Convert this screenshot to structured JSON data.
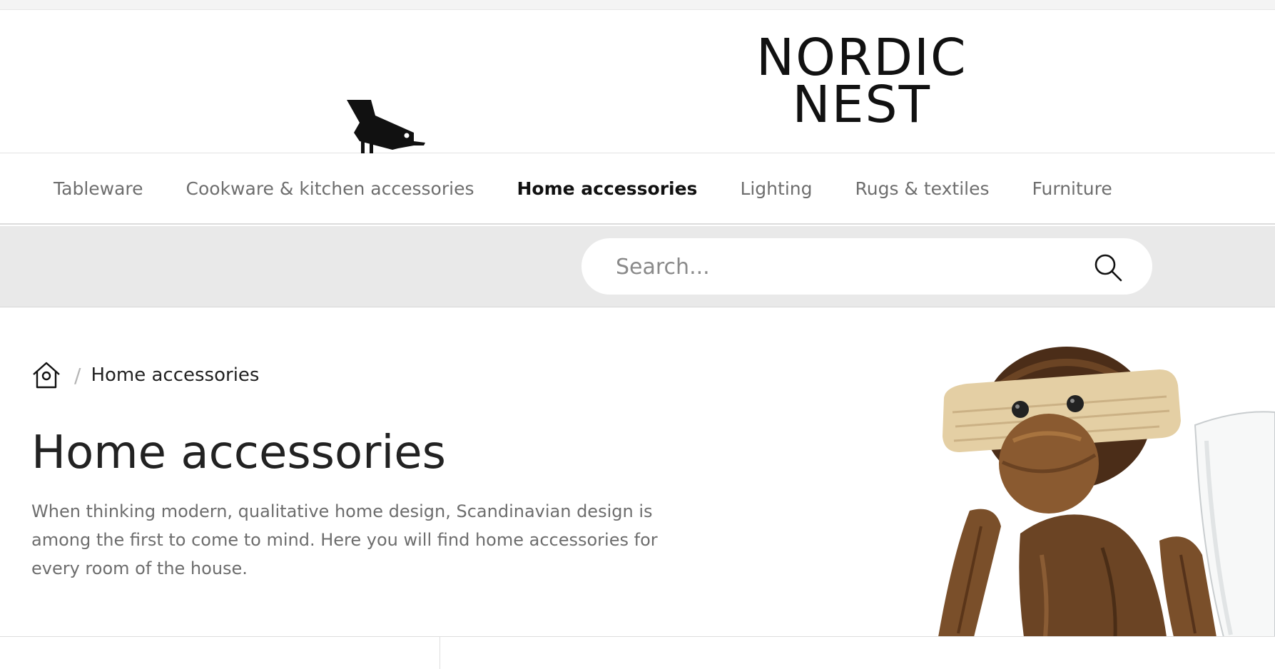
{
  "brand": {
    "logo_line1": "NORDIC",
    "logo_line2": "NEST"
  },
  "nav": {
    "items": [
      {
        "label": "Tableware",
        "active": false
      },
      {
        "label": "Cookware & kitchen accessories",
        "active": false
      },
      {
        "label": "Home accessories",
        "active": true
      },
      {
        "label": "Lighting",
        "active": false
      },
      {
        "label": "Rugs & textiles",
        "active": false
      },
      {
        "label": "Furniture",
        "active": false
      }
    ]
  },
  "search": {
    "placeholder": "Search...",
    "icon": "search-icon"
  },
  "breadcrumb": {
    "home_icon": "home-icon",
    "separator": "/",
    "current": "Home accessories"
  },
  "page": {
    "title": "Home accessories",
    "description": "When thinking modern, qualitative home design, Scandinavian design is among the first to come to mind. Here you will find home accessories for every room of the house."
  },
  "colors": {
    "search_band": "#e9e9e9",
    "text_dark": "#222222",
    "text_muted": "#6d6d6d"
  }
}
